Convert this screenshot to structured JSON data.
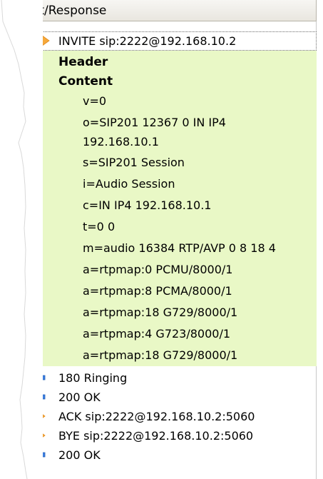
{
  "panel": {
    "title": "equest/Response"
  },
  "messages": {
    "invite": "INVITE sip:2222@192.168.10.2",
    "ringing": "180 Ringing",
    "ok1": "200 OK",
    "ack": "ACK sip:2222@192.168.10.2:5060",
    "bye": "BYE sip:2222@192.168.10.2:5060",
    "ok2": "200 OK"
  },
  "tree": {
    "header_label": "Header",
    "content_label": "Content"
  },
  "sdp": {
    "v": "v=0",
    "o1": "o=SIP201 12367 0 IN IP4",
    "o2": "192.168.10.1",
    "s": "s=SIP201 Session",
    "i": "i=Audio Session",
    "c": "c=IN IP4 192.168.10.1",
    "t": "t=0 0",
    "m": "m=audio 16384 RTP/AVP 0 8 18 4",
    "a1": "a=rtpmap:0 PCMU/8000/1",
    "a2": "a=rtpmap:8 PCMA/8000/1",
    "a3": "a=rtpmap:18 G729/8000/1",
    "a4": "a=rtpmap:4 G723/8000/1",
    "a5": "a=rtpmap:18 G729/8000/1"
  },
  "colors": {
    "outgoing_arrow": "#f6a93b",
    "incoming_arrow": "#3d7fe0",
    "content_bg": "#e9f8c6"
  },
  "icons": {
    "outgoing": "arrow-right-icon",
    "incoming": "arrow-left-icon"
  }
}
